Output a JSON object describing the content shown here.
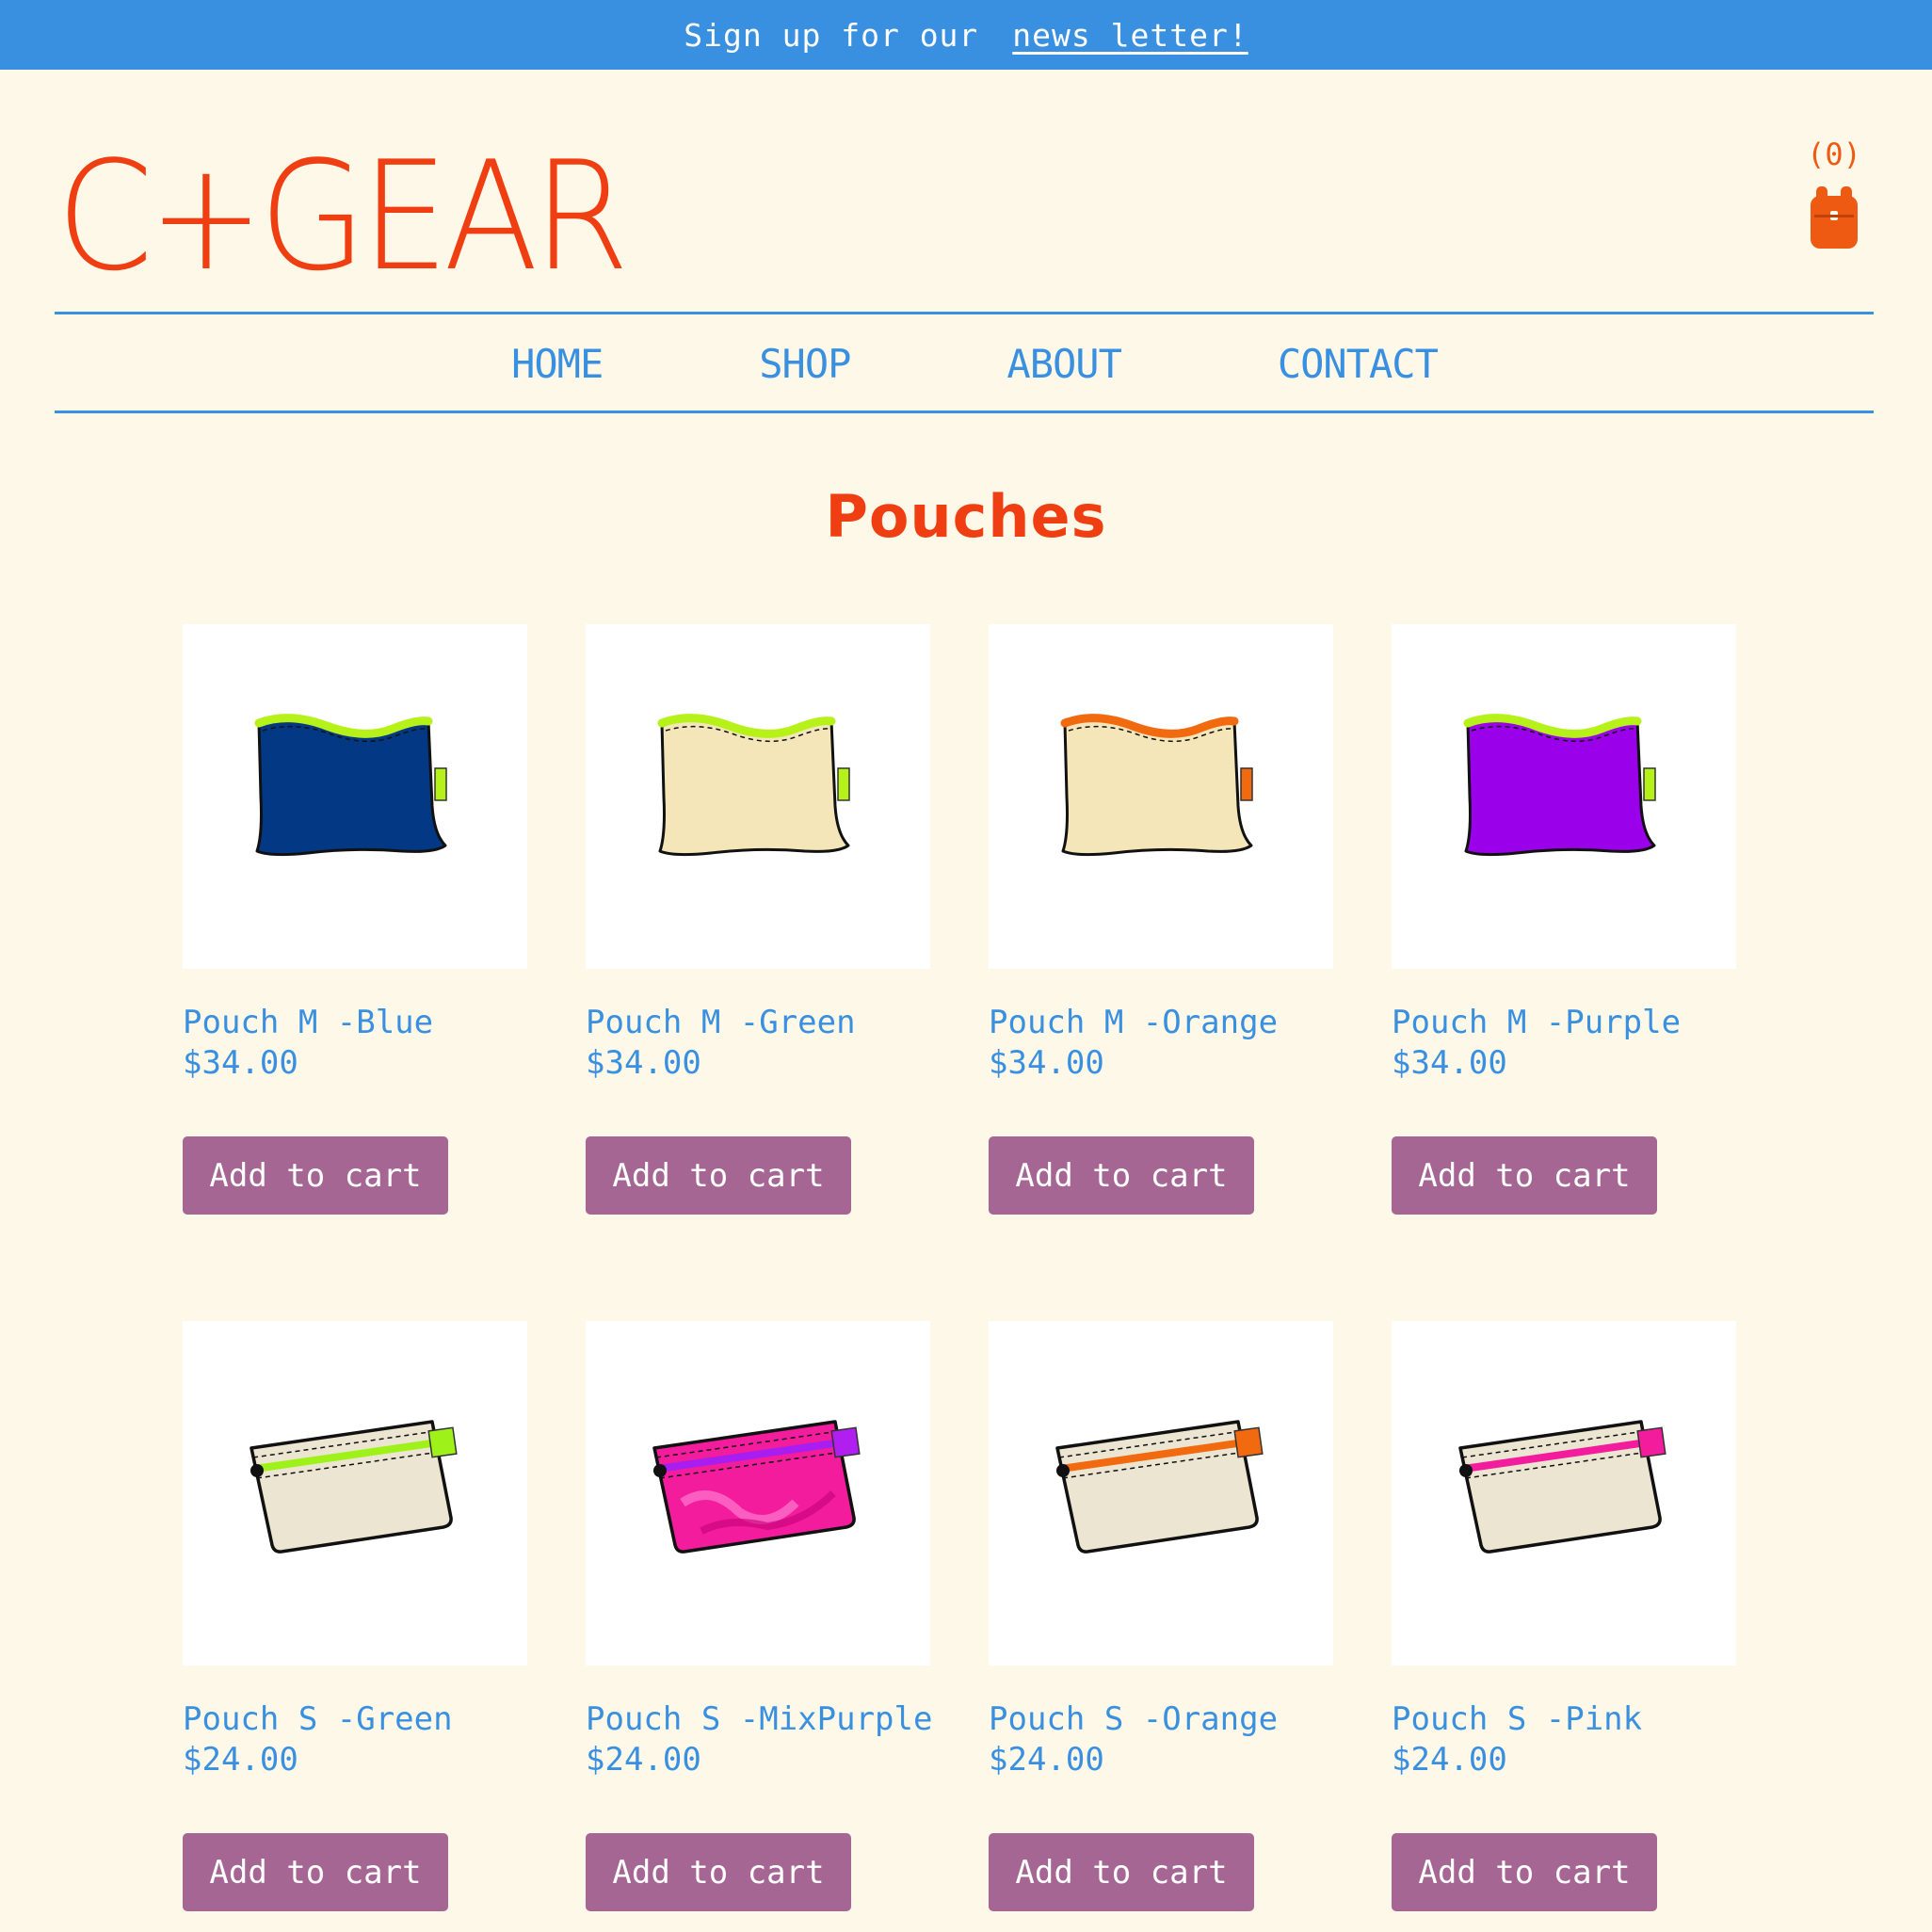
{
  "banner": {
    "lead": "Sign up for our",
    "link": "news letter!"
  },
  "brand": {
    "logo": "C+GEAR"
  },
  "cart": {
    "count": "(0)"
  },
  "nav": [
    {
      "label": "HOME"
    },
    {
      "label": "SHOP"
    },
    {
      "label": "ABOUT"
    },
    {
      "label": "CONTACT"
    }
  ],
  "page": {
    "title": "Pouches"
  },
  "colors": {
    "banner": "#3a90e0",
    "brand": "#ef3e12",
    "link": "#3a90e0",
    "button": "#a56694",
    "background": "#fef8e8"
  },
  "products": [
    {
      "name": "Pouch M -Blue",
      "price": "$34.00",
      "button": "Add to cart",
      "icon": "pouch-m-blue-icon"
    },
    {
      "name": "Pouch M -Green",
      "price": "$34.00",
      "button": "Add to cart",
      "icon": "pouch-m-green-icon"
    },
    {
      "name": "Pouch M -Orange",
      "price": "$34.00",
      "button": "Add to cart",
      "icon": "pouch-m-orange-icon"
    },
    {
      "name": "Pouch M -Purple",
      "price": "$34.00",
      "button": "Add to cart",
      "icon": "pouch-m-purple-icon"
    },
    {
      "name": "Pouch S -Green",
      "price": "$24.00",
      "button": "Add to cart",
      "icon": "pouch-s-green-icon"
    },
    {
      "name": "Pouch S -MixPurple",
      "price": "$24.00",
      "button": "Add to cart",
      "icon": "pouch-s-mixpurple-icon"
    },
    {
      "name": "Pouch S -Orange",
      "price": "$24.00",
      "button": "Add to cart",
      "icon": "pouch-s-orange-icon"
    },
    {
      "name": "Pouch S -Pink",
      "price": "$24.00",
      "button": "Add to cart",
      "icon": "pouch-s-pink-icon"
    }
  ]
}
